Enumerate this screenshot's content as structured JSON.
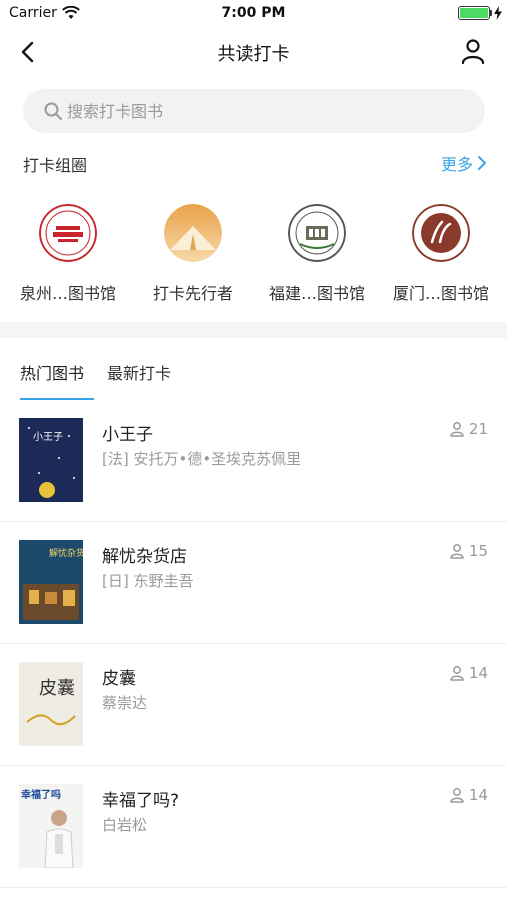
{
  "status_bar": {
    "carrier": "Carrier",
    "time": "7:00 PM",
    "battery_level": 1.0
  },
  "nav": {
    "title": "共读打卡",
    "back_icon": "chevron-left-icon",
    "profile_icon": "person-icon"
  },
  "search": {
    "placeholder": "搜索打卡图书",
    "value": ""
  },
  "groups_section": {
    "title": "打卡组圈",
    "more_label": "更多",
    "items": [
      {
        "name": "泉州…图书馆"
      },
      {
        "name": "打卡先行者"
      },
      {
        "name": "福建…图书馆"
      },
      {
        "name": "厦门…图书馆"
      }
    ]
  },
  "tabs": [
    {
      "label": "热门图书",
      "active": true
    },
    {
      "label": "最新打卡",
      "active": false
    }
  ],
  "books": [
    {
      "title": "小王子",
      "author": "[法] 安托万•德•圣埃克苏佩里",
      "count": "21",
      "cover_text": "小王子"
    },
    {
      "title": "解忧杂货店",
      "author": "[日] 东野圭吾",
      "count": "15",
      "cover_text": "解忧杂货店"
    },
    {
      "title": "皮囊",
      "author": "蔡崇达",
      "count": "14",
      "cover_text": "皮囊"
    },
    {
      "title": "幸福了吗?",
      "author": "白岩松",
      "count": "14",
      "cover_text": "幸福了吗"
    }
  ],
  "colors": {
    "accent": "#3ba3e8",
    "battery": "#4cd964",
    "muted_text": "#9a9a9a"
  }
}
